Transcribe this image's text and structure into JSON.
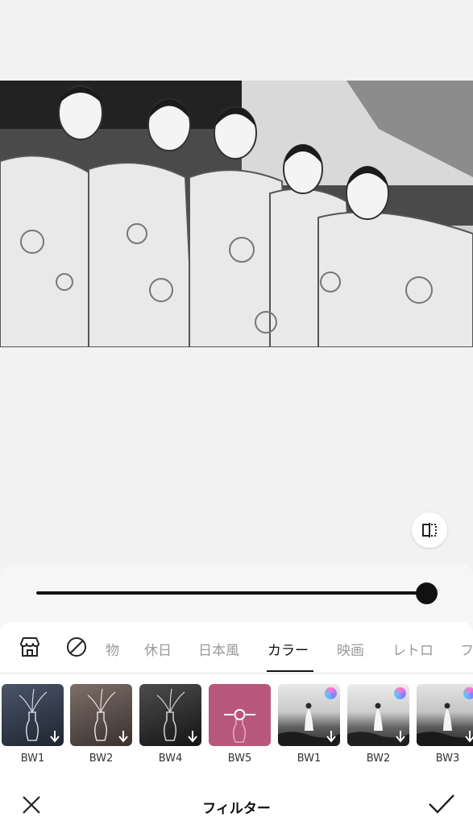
{
  "filter_strength": 1.0,
  "tabs": {
    "items": [
      "物",
      "休日",
      "日本風",
      "カラー",
      "映画",
      "レトロ",
      "フ"
    ],
    "active": "カラー"
  },
  "filters": [
    {
      "label": "BW1",
      "type": "vase"
    },
    {
      "label": "BW2",
      "type": "vase"
    },
    {
      "label": "BW4",
      "type": "vase"
    },
    {
      "label": "BW5",
      "type": "vase"
    },
    {
      "label": "BW1",
      "type": "sea"
    },
    {
      "label": "BW2",
      "type": "sea"
    },
    {
      "label": "BW3",
      "type": "sea"
    }
  ],
  "footer": {
    "title": "フィルター"
  },
  "icons": {
    "store": "store-icon",
    "none": "no-filter-icon",
    "compare": "compare-icon",
    "close": "close-icon",
    "confirm": "check-icon",
    "download": "download-arrow-icon",
    "premium": "premium-badge-icon"
  }
}
